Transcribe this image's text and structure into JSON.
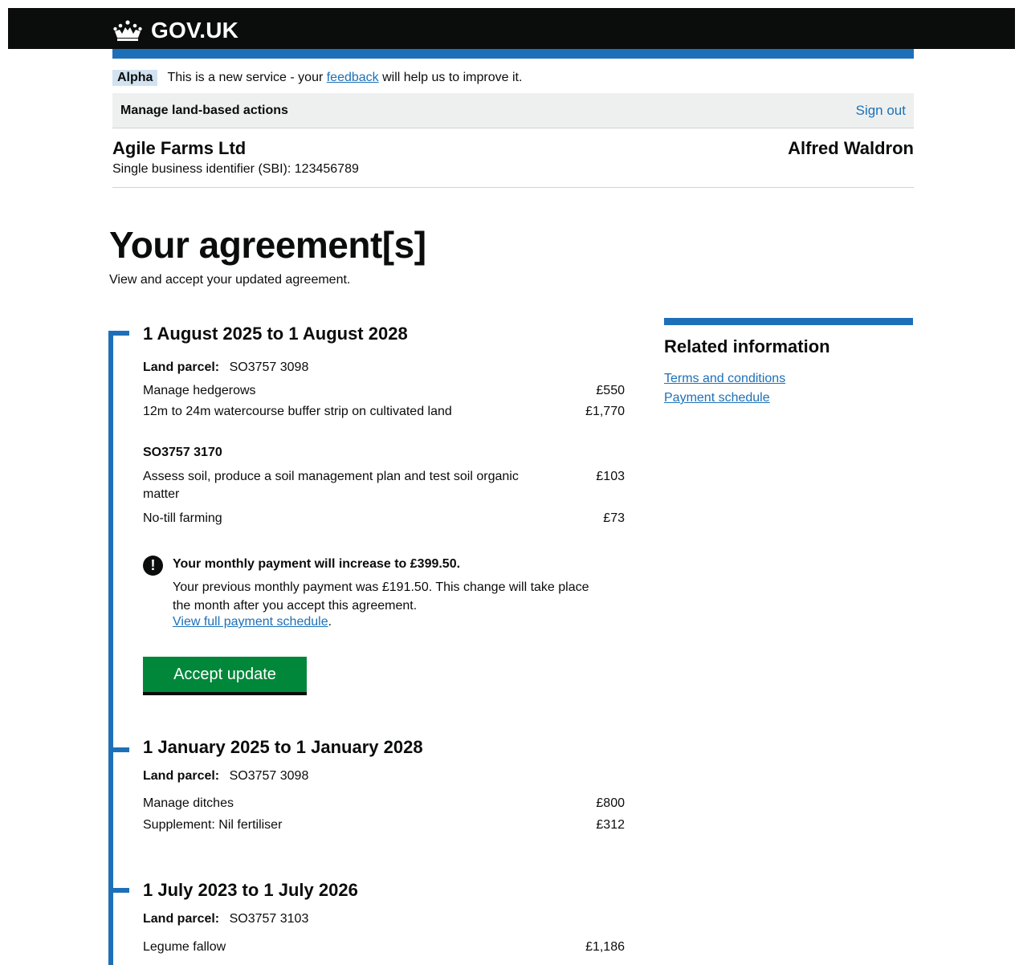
{
  "header": {
    "logo_text": "GOV.UK"
  },
  "phase_banner": {
    "tag": "Alpha",
    "text_before": "This is a new service - your ",
    "link": "feedback",
    "text_after": " will help us to improve it."
  },
  "service_bar": {
    "name": "Manage land-based actions",
    "sign_out": "Sign out"
  },
  "business": {
    "name": "Agile Farms Ltd",
    "sbi": "Single business identifier (SBI): 123456789",
    "user": "Alfred Waldron"
  },
  "page": {
    "title": "Your agreement[s]",
    "lede": "View and accept your updated agreement."
  },
  "agreements": [
    {
      "heading": "1 August 2025 to 1 August 2028",
      "parcel_label": "Land parcel:",
      "parcel": "SO3757 3098",
      "actions": [
        {
          "desc": "Manage hedgerows",
          "amount": "£550"
        },
        {
          "desc": "12m to 24m watercourse buffer strip on cultivated land",
          "amount": "£1,770"
        }
      ],
      "subparcel": "SO3757 3170",
      "sub_actions": [
        {
          "desc": "Assess soil, produce a soil management plan and test soil organic matter",
          "amount": "£103"
        },
        {
          "desc": "No-till farming",
          "amount": "£73"
        }
      ]
    },
    {
      "heading": "1 January 2025 to 1 January 2028",
      "parcel_label": "Land parcel:",
      "parcel": "SO3757 3098",
      "actions": [
        {
          "desc": "Manage ditches",
          "amount": "£800"
        },
        {
          "desc": "Supplement: Nil fertiliser",
          "amount": "£312"
        }
      ]
    },
    {
      "heading": "1 July 2023 to 1 July 2026",
      "parcel_label": "Land parcel:",
      "parcel": "SO3757 3103",
      "actions": [
        {
          "desc": "Legume fallow",
          "amount": "£1,186"
        }
      ]
    }
  ],
  "notice": {
    "icon": "!",
    "title": "Your monthly payment will increase to £399.50.",
    "body": "Your previous monthly payment was £191.50. This change will take place the month after you accept this agreement.",
    "link": "View full payment schedule",
    "link_suffix": "."
  },
  "accept_button": "Accept update",
  "related": {
    "title": "Related information",
    "links": [
      "Terms and conditions",
      "Payment schedule"
    ]
  }
}
